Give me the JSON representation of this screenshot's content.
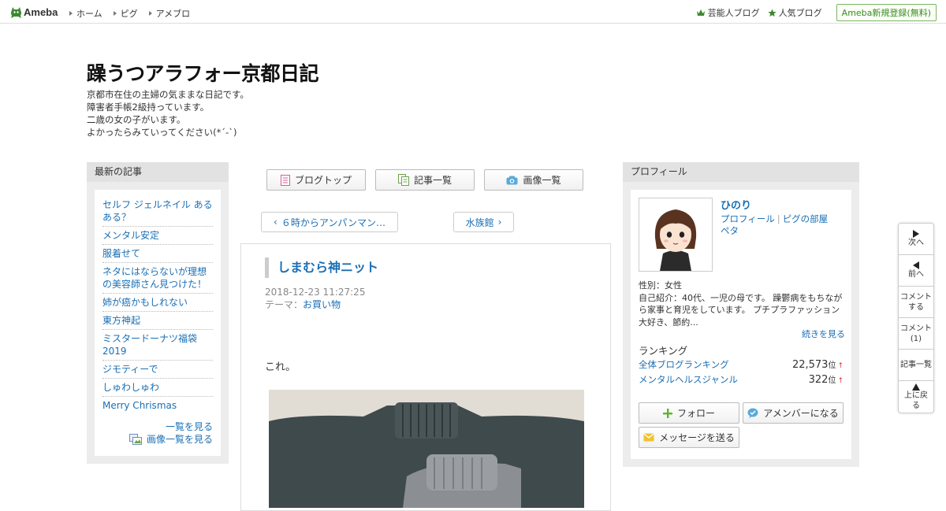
{
  "header": {
    "logo_text": "Ameba",
    "nav": [
      "ホーム",
      "ピグ",
      "アメブロ"
    ],
    "right_links": [
      "芸能人ブログ",
      "人気ブログ"
    ],
    "register_label": "Ameba新規登録(無料)"
  },
  "blog": {
    "title": "躁うつアラフォー京都日記",
    "description": [
      "京都市在住の主婦の気ままな日記です。",
      "障害者手帳2級持っています。",
      "二歳の女の子がいます。",
      "よかったらみていってください(*´-`)"
    ]
  },
  "recent": {
    "heading": "最新の記事",
    "items": [
      "セルフ ジェルネイル あるある？",
      "メンタル安定",
      "服着せて",
      "ネタにはならないが理想の美容師さん見つけた！",
      "姉が癌かもしれない",
      "東方神起",
      "ミスタードーナツ福袋2019",
      "ジモティーで",
      "しゅわしゅわ",
      "Merry Chrismas"
    ],
    "more_label": "一覧を見る",
    "images_label": "画像一覧を見る"
  },
  "center": {
    "buttons": [
      "ブログトップ",
      "記事一覧",
      "画像一覧"
    ],
    "prev_label": "６時からアンパンマン…",
    "next_label": "水族館"
  },
  "article": {
    "title": "しまむら神ニット",
    "date": "2018-12-23 11:27:25",
    "theme_label": "テーマ：",
    "theme": "お買い物",
    "body": "これ。"
  },
  "profile": {
    "heading": "プロフィール",
    "name": "ひのり",
    "link_profile": "プロフィール",
    "link_pig": "ピグの部屋",
    "link_peta": "ペタ",
    "gender": "性別：女性",
    "intro": "自己紹介：40代、一児の母です。 躁鬱病をもちながら家事と育児をしています。 プチプラファッション大好き、節約...",
    "more_label": "続きを見る",
    "ranking_heading": "ランキング",
    "rankings": [
      {
        "label": "全体ブログランキング",
        "value": "22,573",
        "unit": "位",
        "trend": "↑"
      },
      {
        "label": "メンタルヘルスジャンル",
        "value": "322",
        "unit": "位",
        "trend": "↑"
      }
    ],
    "follow_label": "フォロー",
    "amember_label": "アメンバーになる",
    "message_label": "メッセージを送る"
  },
  "float_nav": {
    "next": "次へ",
    "prev": "前へ",
    "comment_line1": "コメント",
    "comment_line2": "する",
    "comment_count_line1": "コメント",
    "comment_count_line2": "(1)",
    "entries": "記事一覧",
    "top_line1": "上に戻",
    "top_line2": "る"
  },
  "colors": {
    "link": "#1a6fb5",
    "panel_bg": "#ececec",
    "accent_green": "#3a8b1f"
  }
}
